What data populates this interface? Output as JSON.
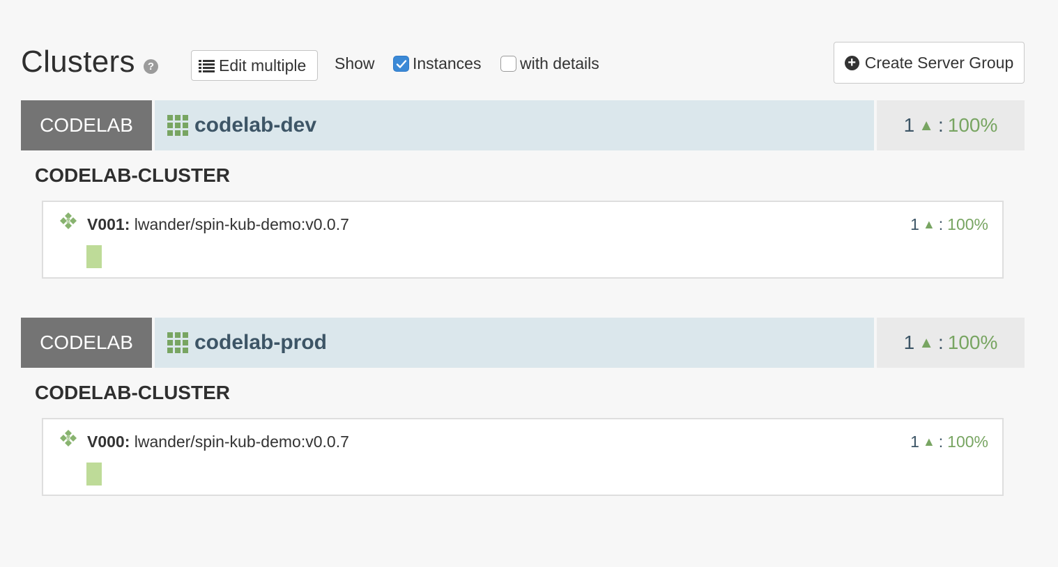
{
  "header": {
    "title": "Clusters",
    "help_glyph": "?",
    "edit_multiple_label": "Edit multiple",
    "show_label": "Show",
    "instances_label": "Instances",
    "instances_checked": true,
    "with_details_label": "with details",
    "with_details_checked": false,
    "create_server_group_label": "Create Server Group"
  },
  "colors": {
    "account_tag": "#747474",
    "app_bar": "#dbe7ec",
    "health_bar": "#eaeaea",
    "healthy_green": "#78a562",
    "instance_up": "#bedb98",
    "checkbox_blue": "#3b89d6"
  },
  "groups": [
    {
      "account": "CODELAB",
      "app_name": "codelab-dev",
      "health": {
        "count": "1",
        "up_glyph": "▲",
        "separator": ":",
        "percent": "100%"
      },
      "cluster": "CODELAB-CLUSTER",
      "server_group": {
        "version": "V001:",
        "image": "lwander/spin-kub-demo:v0.0.7",
        "health": {
          "count": "1",
          "up_glyph": "▲",
          "separator": ":",
          "percent": "100%"
        },
        "instances": [
          {
            "status": "up"
          }
        ]
      }
    },
    {
      "account": "CODELAB",
      "app_name": "codelab-prod",
      "health": {
        "count": "1",
        "up_glyph": "▲",
        "separator": ":",
        "percent": "100%"
      },
      "cluster": "CODELAB-CLUSTER",
      "server_group": {
        "version": "V000:",
        "image": "lwander/spin-kub-demo:v0.0.7",
        "health": {
          "count": "1",
          "up_glyph": "▲",
          "separator": ":",
          "percent": "100%"
        },
        "instances": [
          {
            "status": "up"
          }
        ]
      }
    }
  ],
  "icons": {
    "help": "question-circle-icon",
    "edit": "list-icon",
    "create": "plus-circle-icon",
    "app": "grid-icon",
    "server_group": "cube-stack-icon"
  }
}
